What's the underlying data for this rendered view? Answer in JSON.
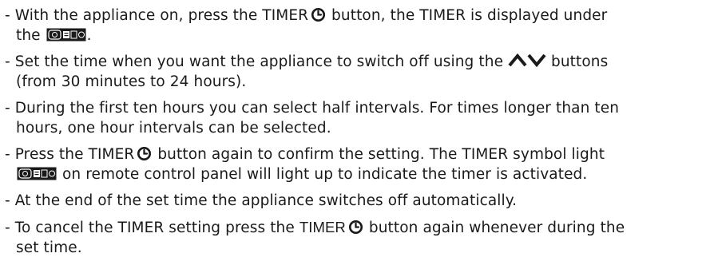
{
  "document": {
    "items": [
      {
        "l1_a": "- With the appliance on, press the TIMER",
        "l1_b": " button, the TIMER is displayed under",
        "l2_a": "the",
        "l2_b": "."
      },
      {
        "l1_a": "- Set the time when you want the appliance to switch off using the",
        "l1_b": " buttons",
        "l2": "(from 30 minutes to 24 hours)."
      },
      {
        "l1": "- During the first ten hours you can select half intervals. For times longer than ten",
        "l2": "hours, one hour intervals can be selected."
      },
      {
        "l1_a": "- Press the TIMER",
        "l1_b": "  button again to confirm the setting. The TIMER symbol light",
        "l2_b": " on remote control panel will light up to indicate the timer is activated."
      },
      {
        "l1": "- At the end of the set time the appliance switches off automatically."
      },
      {
        "l1_a": "- To cancel the TIMER setting press the ",
        "l1_timer": "TIMER",
        "l1_b": " button again whenever during the",
        "l2": "set time."
      }
    ]
  },
  "icons": {
    "timer": "timer-clock-icon",
    "up": "chevron-up-icon",
    "down": "chevron-down-icon",
    "panel": "timer-display-panel-icon"
  }
}
